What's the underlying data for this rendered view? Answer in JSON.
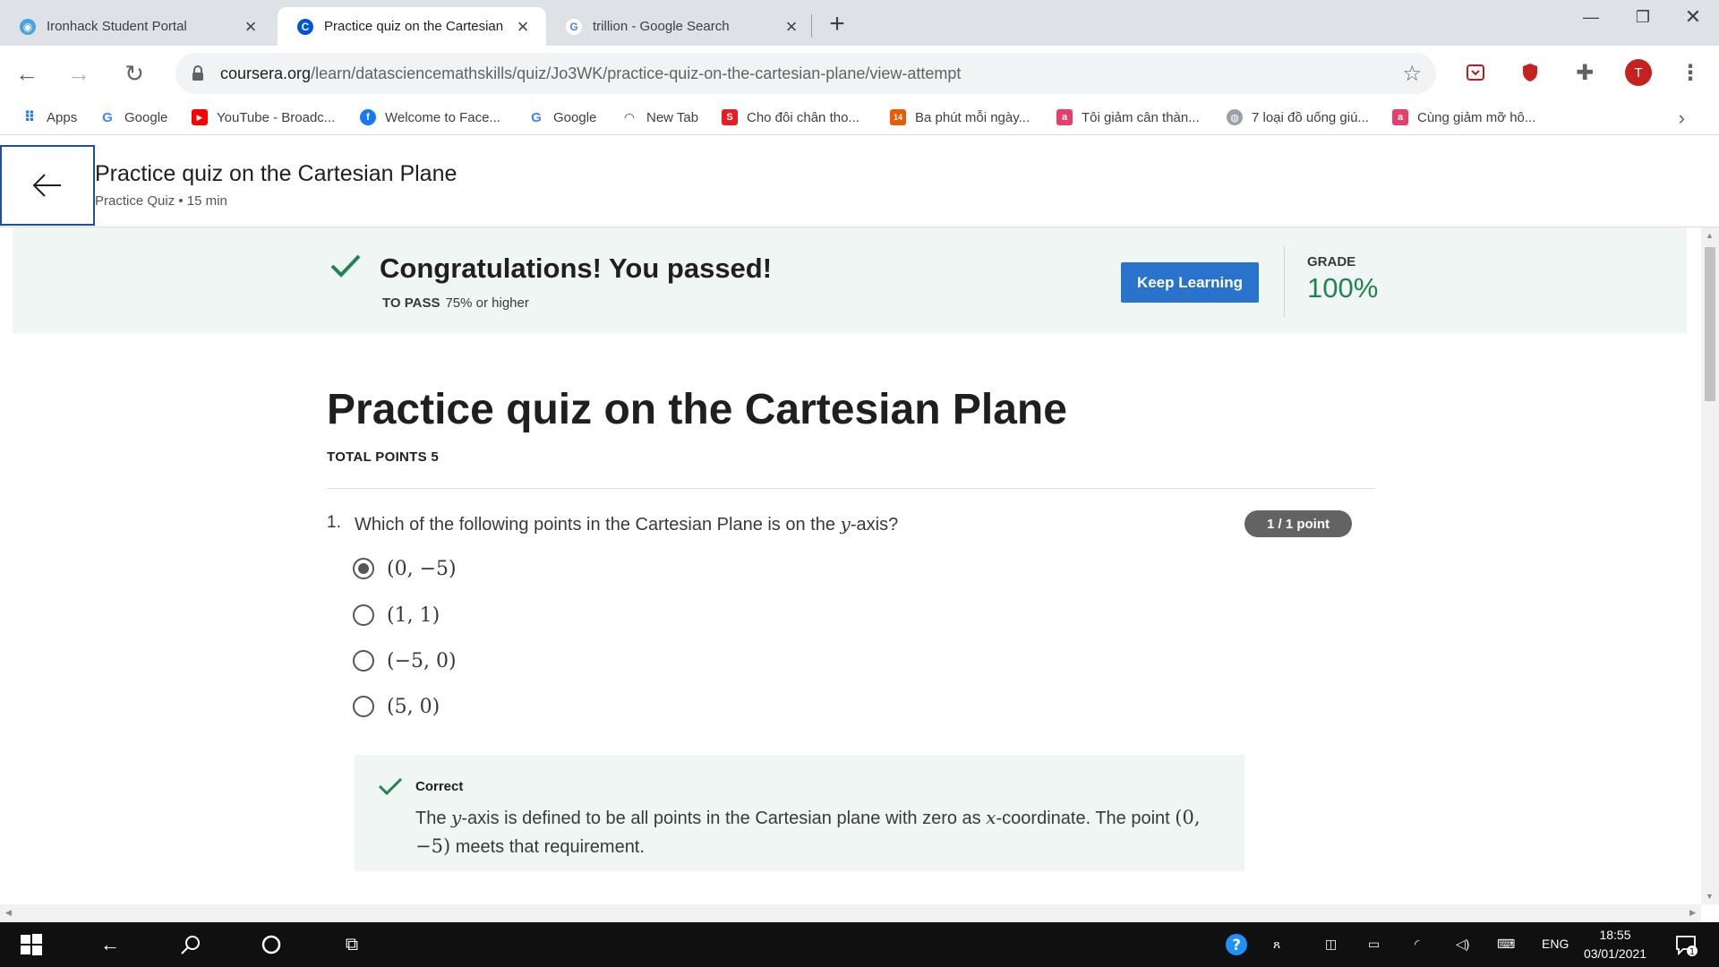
{
  "browser": {
    "tabs": [
      {
        "title": "Ironhack Student Portal",
        "active": false
      },
      {
        "title": "Practice quiz on the Cartesian Plane | Coursera",
        "active": true
      },
      {
        "title": "trillion - Google Search",
        "active": false
      }
    ],
    "new_tab_label": "+",
    "url_host": "coursera.org",
    "url_path": "/learn/datasciencemathskills/quiz/Jo3WK/practice-quiz-on-the-cartesian-plane/view-attempt",
    "profile_initial": "T"
  },
  "bookmarks": [
    {
      "label": "Apps",
      "icon": "apps-grid-icon"
    },
    {
      "label": "Google",
      "icon": "google-icon"
    },
    {
      "label": "YouTube - Broadc...",
      "icon": "youtube-icon"
    },
    {
      "label": "Welcome to Face...",
      "icon": "facebook-icon"
    },
    {
      "label": "Google",
      "icon": "google-icon"
    },
    {
      "label": "New Tab",
      "icon": "newtab-icon"
    },
    {
      "label": "Cho đôi chân tho...",
      "icon": "s-icon"
    },
    {
      "label": "Ba phút mỗi ngày...",
      "icon": "14-icon"
    },
    {
      "label": "Tôi giảm cân thàn...",
      "icon": "a-icon"
    },
    {
      "label": "7 loại đồ uống giú...",
      "icon": "globe-icon"
    },
    {
      "label": "Cùng giảm mỡ hô...",
      "icon": "a-icon"
    }
  ],
  "page_header": {
    "title": "Practice quiz on the Cartesian Plane",
    "subtitle": "Practice Quiz • 15 min"
  },
  "banner": {
    "message": "Congratulations! You passed!",
    "to_pass_label": "TO PASS",
    "to_pass_value": "75% or higher",
    "button_label": "Keep Learning",
    "grade_label": "GRADE",
    "grade_value": "100%",
    "colors": {
      "accent": "#2a73cc",
      "success": "#1f8354"
    }
  },
  "quiz": {
    "title": "Practice quiz on the Cartesian Plane",
    "total_points": "TOTAL POINTS 5",
    "question": {
      "number": "1.",
      "text_before": "Which of the following points in the Cartesian Plane is on the ",
      "var": "y",
      "text_after": "-axis?",
      "points": "1 / 1 point",
      "options": [
        {
          "label": "(0, −5)",
          "selected": true
        },
        {
          "label": "(1, 1)",
          "selected": false
        },
        {
          "label": "(−5, 0)",
          "selected": false
        },
        {
          "label": "(5, 0)",
          "selected": false
        }
      ],
      "feedback": {
        "label": "Correct",
        "t1": "The ",
        "v1": "y",
        "t2": "-axis is defined to be all points in the Cartesian plane with zero as ",
        "v2": "x",
        "t3": "-coordinate. The point ",
        "point": "(0, −5)",
        "t4": " meets that requirement."
      }
    }
  },
  "taskbar": {
    "language": "ENG",
    "time": "18:55",
    "date": "03/01/2021",
    "notification_count": "1"
  }
}
